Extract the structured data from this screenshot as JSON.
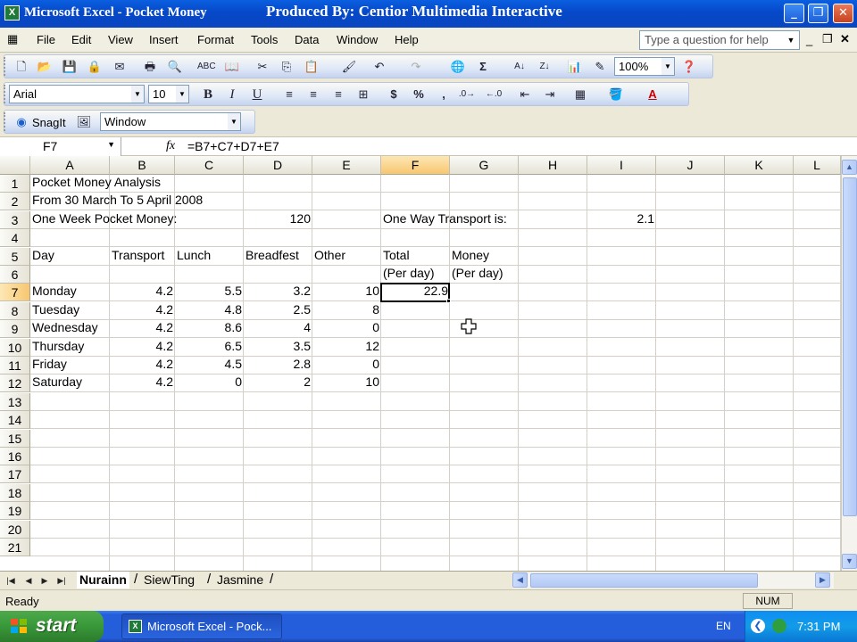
{
  "window": {
    "title": "Microsoft Excel - Pocket Money",
    "overlay_text": "Produced By: Centior Multimedia Interactive",
    "app_icon_glyph": "X"
  },
  "menubar": {
    "items": [
      "File",
      "Edit",
      "View",
      "Insert",
      "Format",
      "Tools",
      "Data",
      "Window",
      "Help"
    ],
    "ask_placeholder": "Type a question for help"
  },
  "toolbar": {
    "zoom": "100%",
    "font_name": "Arial",
    "font_size": "10",
    "snagit_label": "SnagIt",
    "snagit_combo": "Window"
  },
  "formula_bar": {
    "name_box": "F7",
    "fx_label": "fx",
    "formula": "=B7+C7+D7+E7"
  },
  "sheet": {
    "columns": [
      "A",
      "B",
      "C",
      "D",
      "E",
      "F",
      "G",
      "H",
      "I",
      "J",
      "K",
      "L"
    ],
    "selected_column": "F",
    "rows": [
      "1",
      "2",
      "3",
      "4",
      "5",
      "6",
      "7",
      "8",
      "9",
      "10",
      "11",
      "12",
      "13",
      "14",
      "15",
      "16",
      "17",
      "18",
      "19",
      "20",
      "21"
    ],
    "selected_row": "7",
    "cells": {
      "A1": "Pocket Money Analysis",
      "A2": "From 30 March To 5 April 2008",
      "A3": "One Week Pocket Money:",
      "D3": "120",
      "F3": "One Way Transport is:",
      "I3": "2.1",
      "A5": "Day",
      "B5": "Transport",
      "C5": "Lunch",
      "D5": "Breadfest",
      "E5": "Other",
      "F5": "Total",
      "G5": "Money",
      "F6": "(Per day)",
      "G6": "(Per day)",
      "A7": "Monday",
      "B7": "4.2",
      "C7": "5.5",
      "D7": "3.2",
      "E7": "10",
      "F7": "22.9",
      "A8": "Tuesday",
      "B8": "4.2",
      "C8": "4.8",
      "D8": "2.5",
      "E8": "8",
      "A9": "Wednesday",
      "B9": "4.2",
      "C9": "8.6",
      "D9": "4",
      "E9": "0",
      "A10": "Thursday",
      "B10": "4.2",
      "C10": "6.5",
      "D10": "3.5",
      "E10": "12",
      "A11": "Friday",
      "B11": "4.2",
      "C11": "4.5",
      "D11": "2.8",
      "E11": "0",
      "A12": "Saturday",
      "B12": "4.2",
      "C12": "0",
      "D12": "2",
      "E12": "10"
    },
    "tabs": [
      "Nurainn",
      "SiewTing",
      "Jasmine"
    ],
    "active_tab": "Nurainn"
  },
  "statusbar": {
    "status": "Ready",
    "num": "NUM"
  },
  "taskbar": {
    "start_label": "start",
    "task_item": "Microsoft Excel - Pock...",
    "language": "EN",
    "clock": "7:31 PM"
  },
  "colors": {
    "titlebar": "#0548c8",
    "selection_header": "#f8c770",
    "taskbar": "#245edb",
    "start_button": "#3a9a3a"
  }
}
